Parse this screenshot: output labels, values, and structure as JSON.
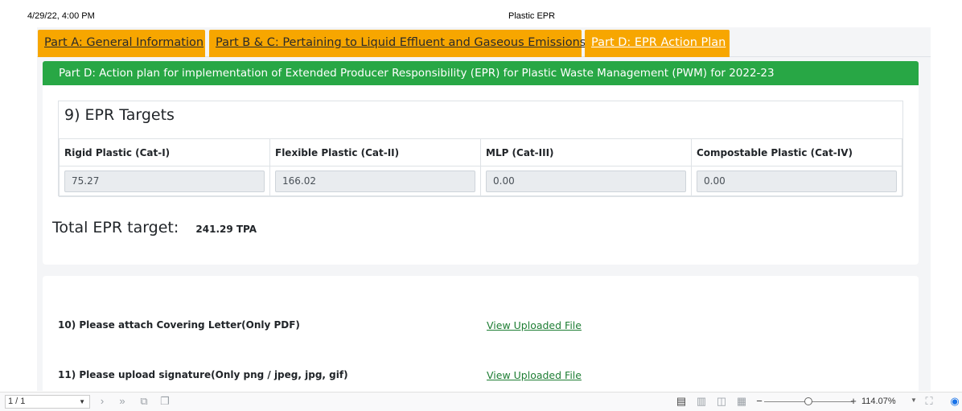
{
  "print_header": {
    "date": "4/29/22, 4:00 PM",
    "title": "Plastic EPR"
  },
  "tabs": [
    {
      "label": "Part A: General Information"
    },
    {
      "label": "Part B & C: Pertaining to Liquid Effluent and Gaseous Emissions"
    },
    {
      "label": "Part D: EPR Action Plan"
    }
  ],
  "section_banner": "Part D: Action plan for implementation of Extended Producer Responsibility (EPR) for Plastic Waste Management (PWM) for 2022-23",
  "epr_targets": {
    "title": "9) EPR Targets",
    "columns": [
      "Rigid Plastic (Cat-I)",
      "Flexible Plastic (Cat-II)",
      "MLP (Cat-III)",
      "Compostable Plastic (Cat-IV)"
    ],
    "values": [
      "75.27",
      "166.02",
      "0.00",
      "0.00"
    ]
  },
  "total": {
    "label": "Total EPR target:",
    "value": "241.29 TPA"
  },
  "uploads": [
    {
      "question": "10) Please attach Covering Letter(Only PDF)",
      "link": "View Uploaded File"
    },
    {
      "question": "11) Please upload signature(Only png / jpeg, jpg, gif)",
      "link": "View Uploaded File"
    }
  ],
  "viewer_toolbar": {
    "page": "1 / 1",
    "zoom": "114.07%",
    "icons": [
      "page-dropdown-caret-icon",
      "next-page-icon",
      "last-page-icon",
      "rotate-icon",
      "duplicate-icon",
      "single-page-view-icon",
      "continuous-view-icon",
      "two-page-view-icon",
      "grid-view-icon",
      "zoom-out-icon",
      "zoom-in-icon",
      "fullscreen-icon",
      "comment-icon"
    ]
  }
}
